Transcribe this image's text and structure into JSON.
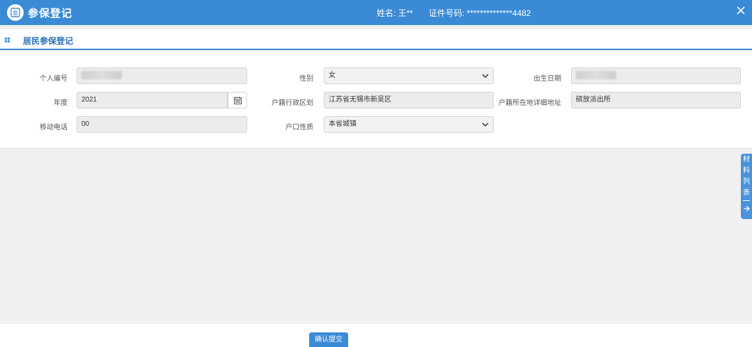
{
  "header": {
    "title": "参保登记",
    "name_label": "姓名:",
    "name_value": "王**",
    "id_label": "证件号码:",
    "id_value": "**************4482",
    "app_icon": "list-icon",
    "close_icon": "close-icon"
  },
  "section": {
    "title": "居民参保登记",
    "icon": "grid-icon"
  },
  "form": {
    "personal_id": {
      "label": "个人编号",
      "value": ""
    },
    "gender": {
      "label": "性别",
      "value": "女"
    },
    "birth_date": {
      "label": "出生日期",
      "value": ""
    },
    "year": {
      "label": "年度",
      "value": "2021",
      "icon": "calendar-icon"
    },
    "household_district": {
      "label": "户籍行政区划",
      "value": "江苏省无锡市新吴区"
    },
    "household_address": {
      "label": "户籍所在地详细地址",
      "value": "硕放派出所"
    },
    "mobile": {
      "label": "移动电话",
      "value": "00"
    },
    "household_type": {
      "label": "户口性质",
      "value": "本省城镇"
    }
  },
  "side_tab": {
    "chars": [
      "材",
      "料",
      "列",
      "表"
    ],
    "icon": "arrow-right-icon"
  },
  "footer": {
    "submit_label": "确认提交"
  },
  "colors": {
    "primary": "#3a8ad6",
    "field_bg": "#ececec",
    "page_bg": "#f0f0f0"
  }
}
